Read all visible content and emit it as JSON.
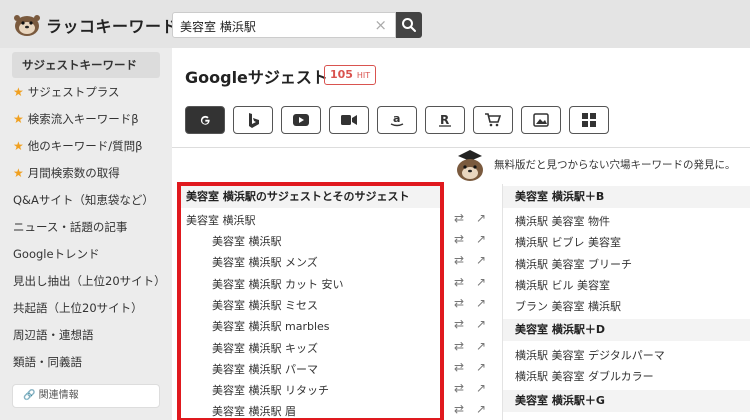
{
  "app": {
    "brand": "ラッコキーワード"
  },
  "search": {
    "value": "美容室 横浜駅",
    "clear": "×"
  },
  "sidebar": {
    "items": [
      {
        "label": "サジェストキーワード",
        "active": true,
        "star": false
      },
      {
        "label": "サジェストプラス",
        "star": true
      },
      {
        "label": "検索流入キーワードβ",
        "star": true
      },
      {
        "label": "他のキーワード/質問β",
        "star": true
      },
      {
        "label": "月間検索数の取得",
        "star": true
      },
      {
        "label": "Q&Aサイト（知恵袋など）",
        "star": false
      },
      {
        "label": "ニュース・話題の記事",
        "star": false
      },
      {
        "label": "Googleトレンド",
        "star": false
      },
      {
        "label": "見出し抽出（上位20サイト）",
        "star": false
      },
      {
        "label": "共起語（上位20サイト）",
        "star": false
      },
      {
        "label": "周辺語・連想語",
        "star": false
      },
      {
        "label": "類語・同義語",
        "star": false
      }
    ],
    "related": "関連情報"
  },
  "main": {
    "title": "Googleサジェスト",
    "hit_count": "105",
    "hit_unit": "HIT",
    "engines": [
      "google-icon",
      "bing-icon",
      "youtube-icon",
      "video-icon",
      "amazon-icon",
      "rakuten-icon",
      "shopping-icon",
      "image-icon",
      "apps-icon"
    ],
    "notice": "無料版だと見つからない穴場キーワードの発見に。"
  },
  "left_panel": {
    "heading": "美容室 横浜駅のサジェストとそのサジェスト",
    "root": "美容室 横浜駅",
    "keywords": [
      "美容室 横浜駅",
      "美容室 横浜駅 メンズ",
      "美容室 横浜駅 カット 安い",
      "美容室 横浜駅 ミセス",
      "美容室 横浜駅 marbles",
      "美容室 横浜駅 キッズ",
      "美容室 横浜駅 パーマ",
      "美容室 横浜駅 リタッチ",
      "美容室 横浜駅 眉"
    ]
  },
  "right_panel": {
    "groups": [
      {
        "heading": "美容室 横浜駅＋B",
        "keywords": [
          "横浜駅 美容室 物件",
          "横浜駅 ビブレ 美容室",
          "横浜駅 美容室 ブリーチ",
          "横浜駅 ビル 美容室",
          "ブラン 美容室 横浜駅"
        ]
      },
      {
        "heading": "美容室 横浜駅＋D",
        "keywords": [
          "横浜駅 美容室 デジタルパーマ",
          "横浜駅 美容室 ダブルカラー"
        ]
      },
      {
        "heading": "美容室 横浜駅＋G",
        "keywords": []
      }
    ]
  },
  "colors": {
    "highlight": "#e0191e",
    "accent": "#f0a020",
    "badge": "#d9534f"
  }
}
